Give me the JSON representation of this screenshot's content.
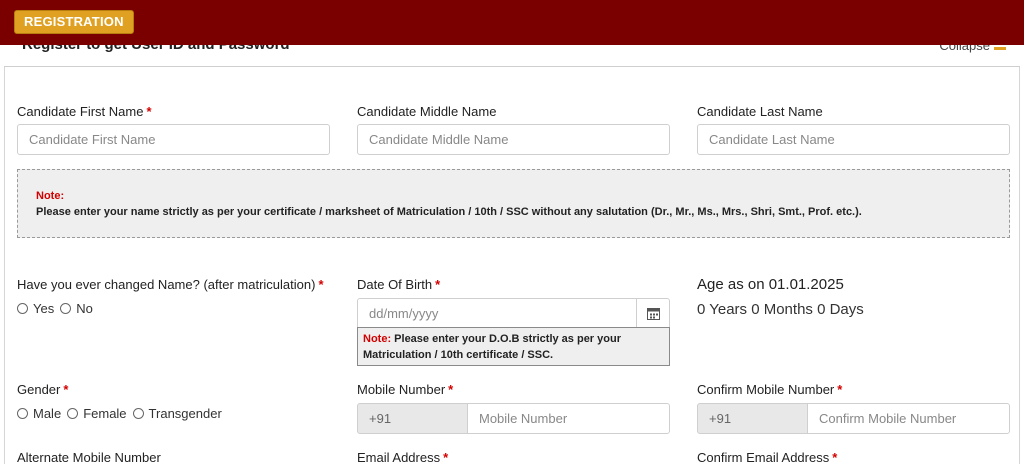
{
  "header": {
    "badge": "REGISTRATION",
    "panel_title": "Register to get User ID and Password",
    "collapse_label": "Collapse"
  },
  "fields": {
    "first_name": {
      "label": "Candidate First Name",
      "placeholder": "Candidate First Name",
      "required": "*"
    },
    "middle_name": {
      "label": "Candidate Middle Name",
      "placeholder": "Candidate Middle Name"
    },
    "last_name": {
      "label": "Candidate Last Name",
      "placeholder": "Candidate Last Name"
    },
    "name_changed": {
      "label": "Have you ever changed Name? (after matriculation)",
      "required": "*",
      "options": [
        "Yes",
        "No"
      ]
    },
    "dob": {
      "label": "Date Of Birth",
      "required": "*",
      "placeholder": "dd/mm/yyyy"
    },
    "gender": {
      "label": "Gender",
      "required": "*",
      "options": [
        "Male",
        "Female",
        "Transgender"
      ]
    },
    "mobile": {
      "label": "Mobile Number",
      "required": "*",
      "prefix": "+91",
      "placeholder": "Mobile Number"
    },
    "confirm_mobile": {
      "label": "Confirm Mobile Number",
      "required": "*",
      "prefix": "+91",
      "placeholder": "Confirm Mobile Number"
    },
    "alt_mobile": {
      "label": "Alternate Mobile Number"
    },
    "email": {
      "label": "Email Address",
      "required": "*"
    },
    "confirm_email": {
      "label": "Confirm Email Address",
      "required": "*"
    }
  },
  "name_note": {
    "label": "Note:",
    "text": "Please enter your name strictly as per your certificate / marksheet of Matriculation / 10th / SSC without any salutation (Dr., Mr., Ms., Mrs., Shri, Smt., Prof. etc.)."
  },
  "dob_note": {
    "label": "Note:",
    "text": "Please enter your D.O.B strictly as per your Matriculation / 10th certificate / SSC."
  },
  "age": {
    "title": "Age as on 01.01.2025",
    "value": "0 Years 0 Months 0 Days"
  },
  "icons": {
    "calendar": "calendar-icon",
    "collapse": "minus-icon"
  },
  "colors": {
    "header_bg": "#7a0000",
    "badge_bg": "#e0a021",
    "required": "#d40000"
  }
}
